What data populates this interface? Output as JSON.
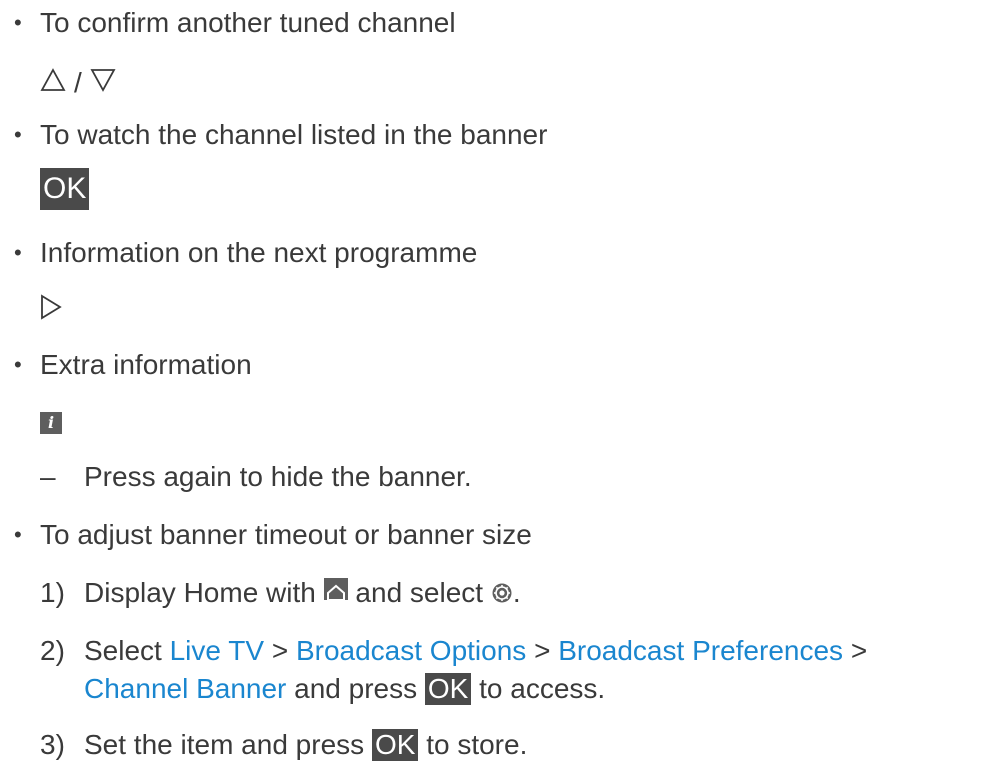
{
  "items": [
    {
      "text": "To confirm another tuned channel",
      "key_separator": "/"
    },
    {
      "text": "To watch the channel listed in the banner",
      "key": "OK"
    },
    {
      "text": "Information on the next programme"
    },
    {
      "text": "Extra information",
      "note": "Press again to hide the banner."
    },
    {
      "text": "To adjust banner timeout or banner size"
    }
  ],
  "steps": [
    {
      "num": "1)",
      "pre": "Display Home with",
      "mid": "and select",
      "end": "."
    },
    {
      "num": "2)",
      "pre": "Select",
      "link1": "Live TV",
      "sep1": ">",
      "link2": "Broadcast Options",
      "sep2": ">",
      "link3": "Broadcast Preferences",
      "sep3": ">",
      "link4": "Channel Banner",
      "mid": "and press",
      "key": "OK",
      "post": "to access."
    },
    {
      "num": "3)",
      "pre": "Set the item and press",
      "key": "OK",
      "post": "to store."
    }
  ],
  "colors": {
    "text": "#3a3a3a",
    "link": "#1a86cf",
    "key_background": "#4a4a4a"
  },
  "icons": [
    "up-triangle-icon",
    "down-triangle-icon",
    "right-triangle-icon",
    "info-icon",
    "home-icon",
    "gear-icon"
  ]
}
